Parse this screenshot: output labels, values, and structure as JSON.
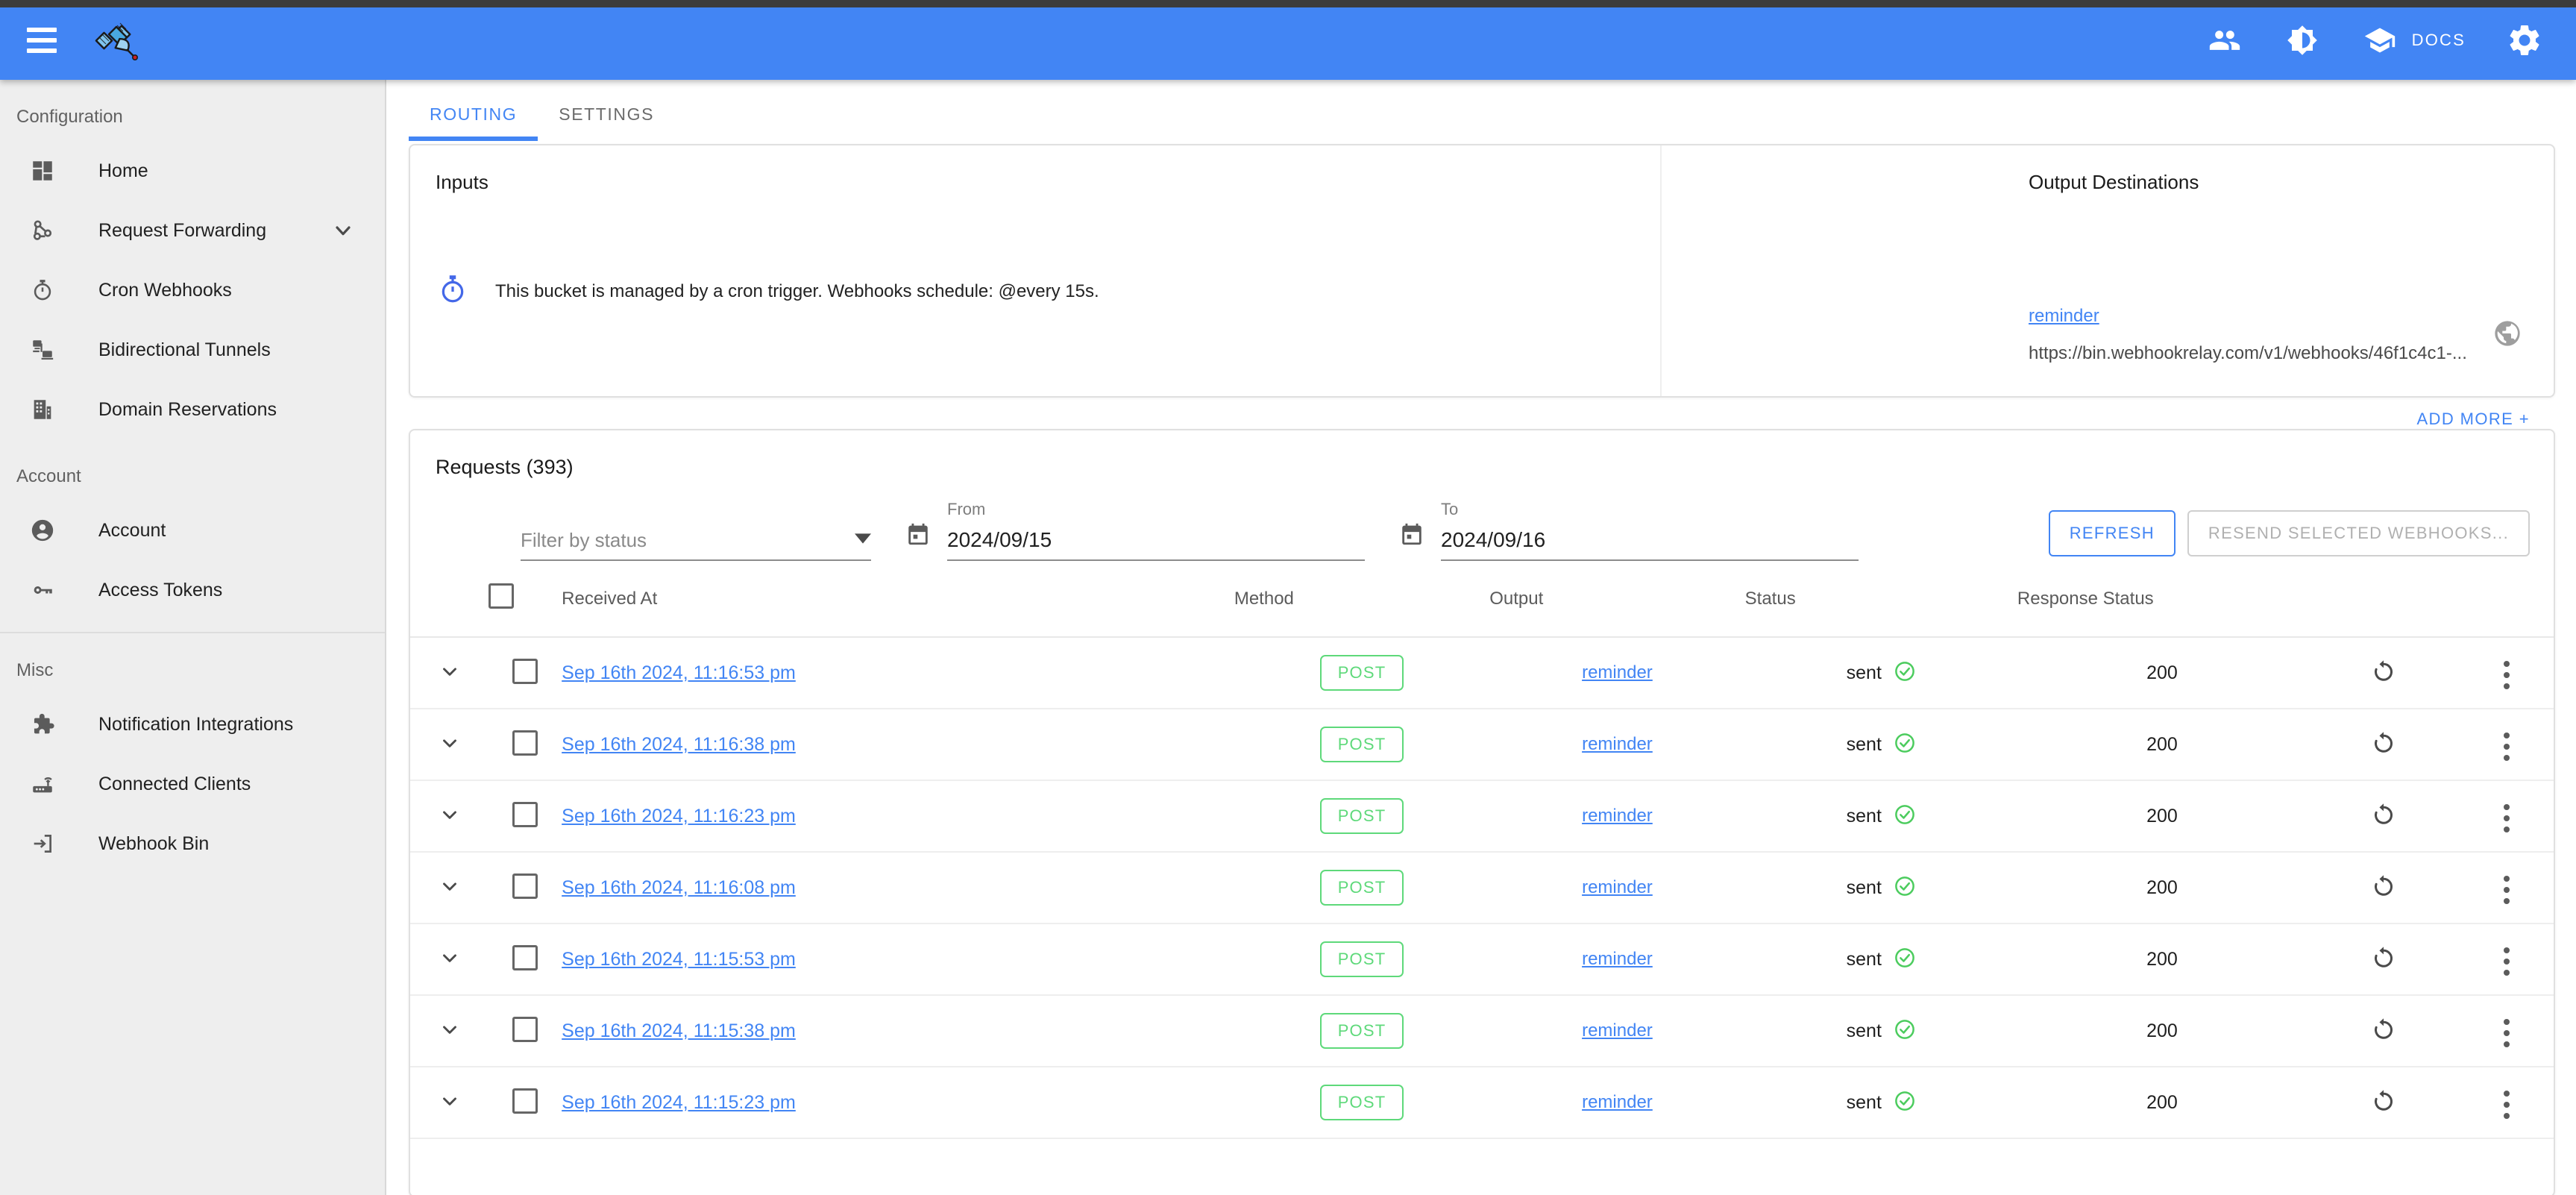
{
  "topbar": {
    "menu_icon": "hamburger-menu-icon",
    "logo_icon": "satellite-logo-icon",
    "actions": [
      {
        "name": "people-icon",
        "label": ""
      },
      {
        "name": "brightness-contrast-icon",
        "label": ""
      }
    ],
    "docs": {
      "icon": "school-cap-icon",
      "label": "DOCS"
    },
    "settings": {
      "icon": "gear-icon",
      "label": ""
    }
  },
  "sidebar": {
    "groups": [
      {
        "label": "Configuration",
        "items": [
          {
            "label": "Home",
            "icon": "dashboard-icon",
            "chevron": false
          },
          {
            "label": "Request Forwarding",
            "icon": "webhook-icon",
            "chevron": true
          },
          {
            "label": "Cron Webhooks",
            "icon": "timer-icon",
            "chevron": false
          },
          {
            "label": "Bidirectional Tunnels",
            "icon": "devices-tunnel-icon",
            "chevron": false
          },
          {
            "label": "Domain Reservations",
            "icon": "building-icon",
            "chevron": false
          }
        ]
      },
      {
        "label": "Account",
        "items": [
          {
            "label": "Account",
            "icon": "account-circle-icon",
            "chevron": false
          },
          {
            "label": "Access Tokens",
            "icon": "key-icon",
            "chevron": false
          }
        ]
      },
      {
        "label": "Misc",
        "items": [
          {
            "label": "Notification Integrations",
            "icon": "puzzle-piece-icon",
            "chevron": false
          },
          {
            "label": "Connected Clients",
            "icon": "router-icon",
            "chevron": false
          },
          {
            "label": "Webhook Bin",
            "icon": "input-arrow-icon",
            "chevron": false
          }
        ]
      }
    ]
  },
  "tabs": [
    {
      "label": "ROUTING",
      "active": true
    },
    {
      "label": "SETTINGS",
      "active": false
    }
  ],
  "routing": {
    "inputs_title": "Inputs",
    "outputs_title": "Output Destinations",
    "cron_icon": "timer-icon",
    "cron_message": "This bucket is managed by a cron trigger. Webhooks schedule: @every 15s.",
    "add_more_label": "ADD MORE +",
    "destination": {
      "name": "reminder",
      "url": "https://bin.webhookrelay.com/v1/webhooks/46f1c4c1-...",
      "globe_icon": "globe-public-icon"
    }
  },
  "requests": {
    "title": "Requests (393)",
    "filter": {
      "placeholder": "Filter by status",
      "caret_icon": "caret-down-icon"
    },
    "from": {
      "label": "From",
      "value": "2024/09/15",
      "icon": "calendar-icon"
    },
    "to": {
      "label": "To",
      "value": "2024/09/16",
      "icon": "calendar-icon"
    },
    "refresh_label": "REFRESH",
    "resend_label": "RESEND SELECTED WEBHOOKS...",
    "columns": [
      "Received At",
      "Method",
      "Output",
      "Status",
      "Response Status"
    ],
    "rows": [
      {
        "received_at": "Sep 16th 2024, 11:16:53 pm",
        "method": "POST",
        "output": "reminder",
        "status": "sent",
        "response_status": "200"
      },
      {
        "received_at": "Sep 16th 2024, 11:16:38 pm",
        "method": "POST",
        "output": "reminder",
        "status": "sent",
        "response_status": "200"
      },
      {
        "received_at": "Sep 16th 2024, 11:16:23 pm",
        "method": "POST",
        "output": "reminder",
        "status": "sent",
        "response_status": "200"
      },
      {
        "received_at": "Sep 16th 2024, 11:16:08 pm",
        "method": "POST",
        "output": "reminder",
        "status": "sent",
        "response_status": "200"
      },
      {
        "received_at": "Sep 16th 2024, 11:15:53 pm",
        "method": "POST",
        "output": "reminder",
        "status": "sent",
        "response_status": "200"
      },
      {
        "received_at": "Sep 16th 2024, 11:15:38 pm",
        "method": "POST",
        "output": "reminder",
        "status": "sent",
        "response_status": "200"
      },
      {
        "received_at": "Sep 16th 2024, 11:15:23 pm",
        "method": "POST",
        "output": "reminder",
        "status": "sent",
        "response_status": "200"
      }
    ]
  },
  "colors": {
    "brand_blue": "#4285f4",
    "link_blue": "#4285f4",
    "success_green": "#5ed97a",
    "sidebar_bg": "#eeeeee"
  }
}
